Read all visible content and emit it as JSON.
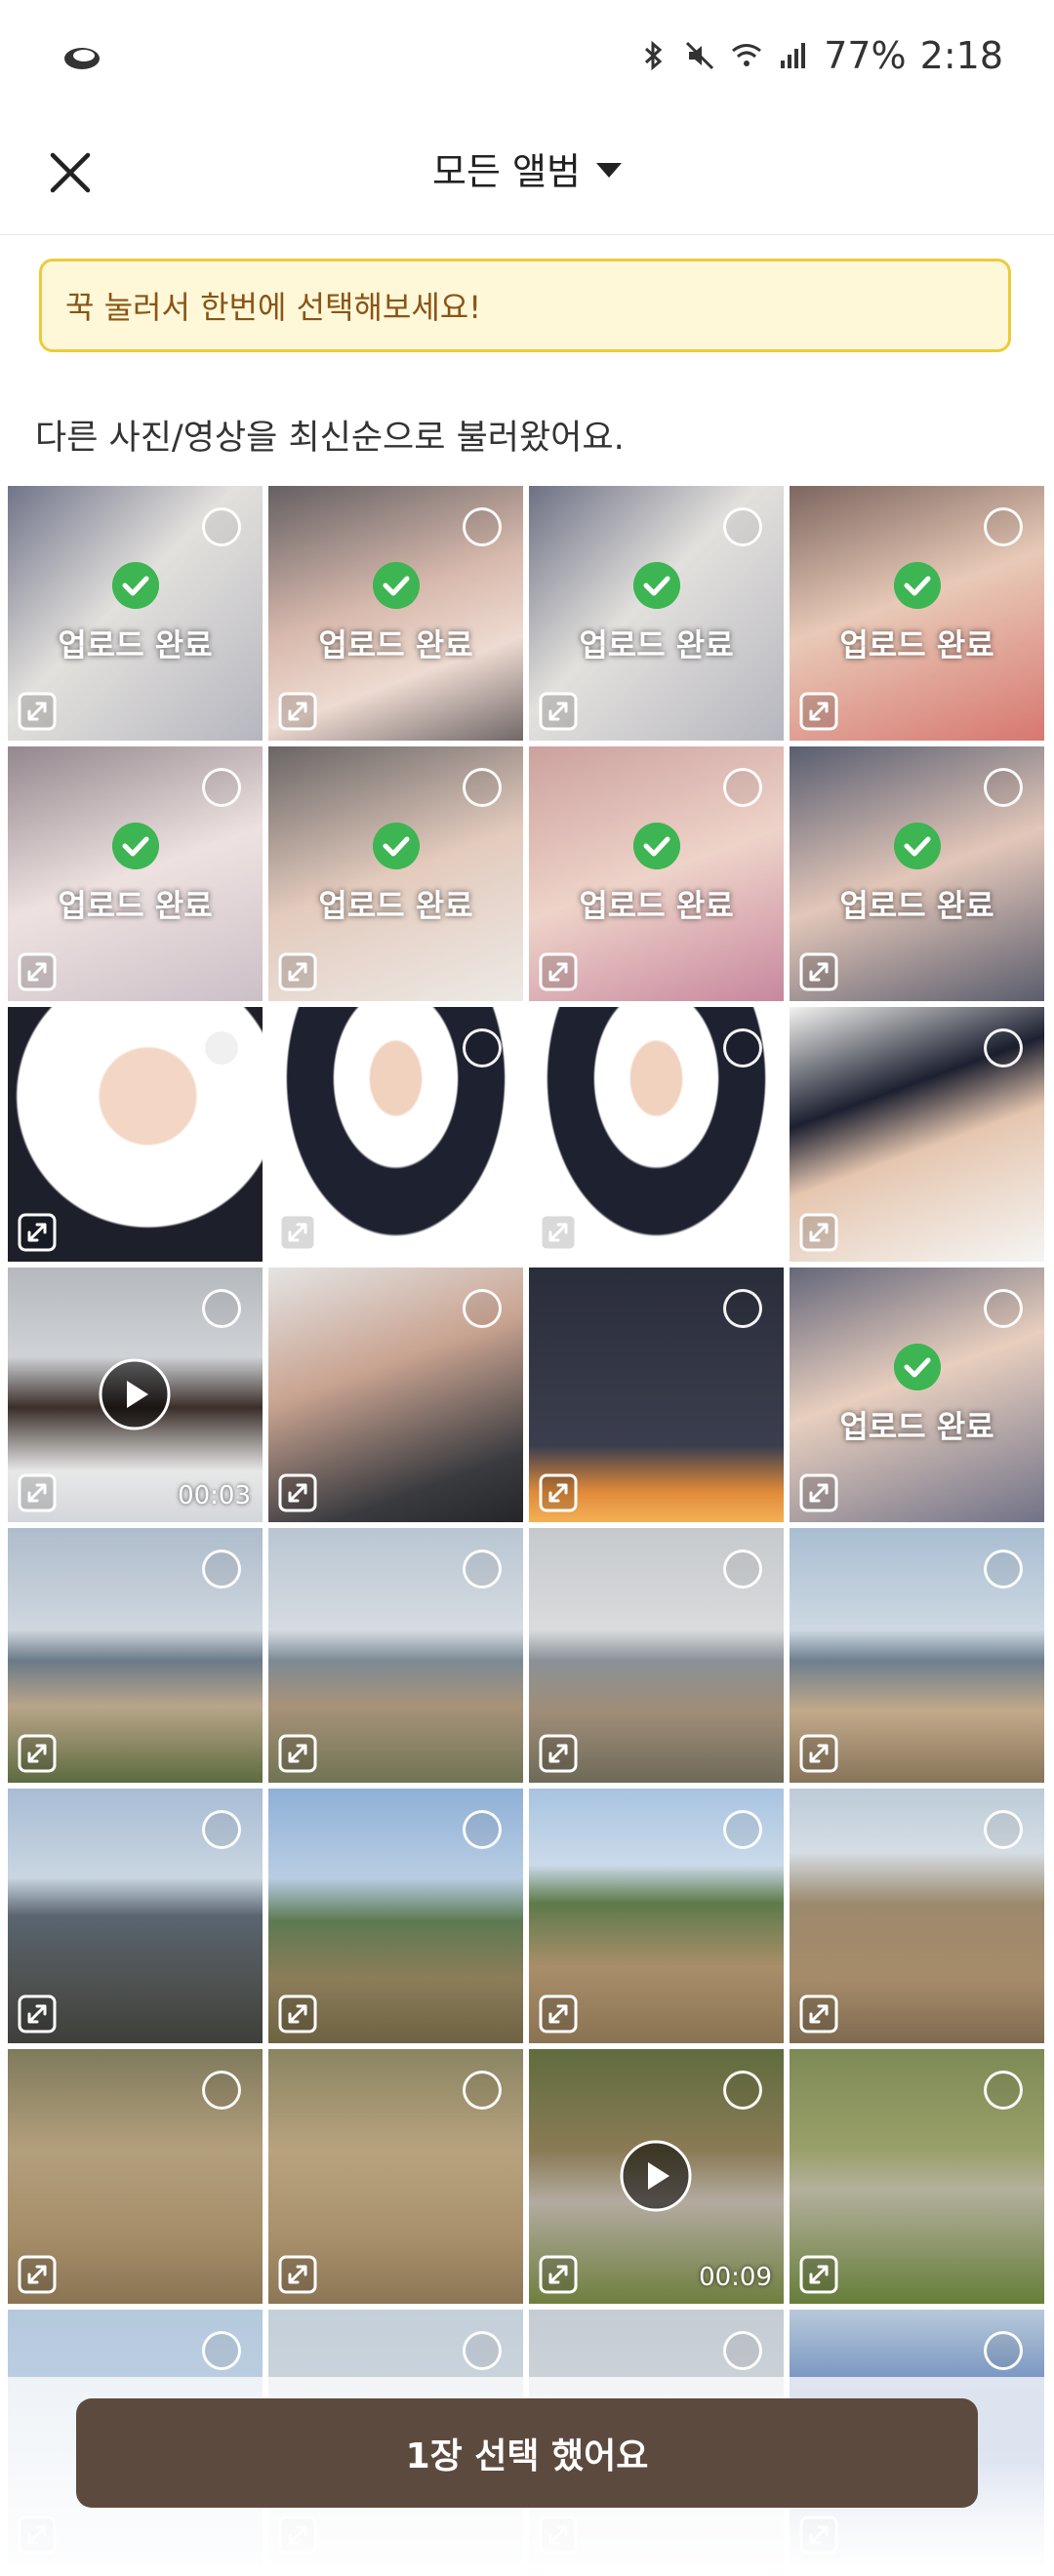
{
  "status_bar": {
    "battery": "77%",
    "time": "2:18"
  },
  "header": {
    "title": "모든 앨범"
  },
  "banner": {
    "text": "꾹 눌러서 한번에 선택해보세요!"
  },
  "subtitle": "다른 사진/영상을 최신순으로 불러왔어요.",
  "grid": {
    "uploaded_label": "업로드 완료",
    "items": [
      {
        "bg": "linear-gradient(135deg,#3a3f5c 0%,#d8d5d0 45%,#9a9aa6 100%)",
        "uploaded": true
      },
      {
        "bg": "linear-gradient(160deg,#2a2326 0%,#c99f8e 45%,#e8cdc0 70%,#3a2e2e 100%)",
        "uploaded": true
      },
      {
        "bg": "linear-gradient(135deg,#353a55 0%,#d8d5d0 45%,#9a9aa6 100%)",
        "uploaded": true
      },
      {
        "bg": "linear-gradient(160deg,#4a2c22 0%,#e0b59c 45%,#c8443a 100%)",
        "uploaded": true
      },
      {
        "bg": "linear-gradient(160deg,#6a5a63 0%,#e8d6d5 50%,#b8a8b2 100%)",
        "uploaded": true
      },
      {
        "bg": "linear-gradient(160deg,#2f2a2a 0%,#d9b7a4 50%,#e6e1dc 100%)",
        "uploaded": true
      },
      {
        "bg": "linear-gradient(160deg,#b87d78 0%,#e8c2b4 50%,#b25a7a 100%)",
        "uploaded": true
      },
      {
        "bg": "linear-gradient(160deg,#18203a 0%,#d8b19e 50%,#1c2036 100%)",
        "uploaded": true
      },
      {
        "bg": "radial-gradient(circle at 55% 35%,#f3d7c4 0%,#f3d7c4 22%,#ffffff 23%,#ffffff 60%,#1d1f2a 61%)",
        "uploaded": false
      },
      {
        "bg": "radial-gradient(ellipse at 50% 28%,#f0d2bf 0%,#f0d2bf 14%,#ffffff 15%,#ffffff 34%,#1e2130 35%,#1e2130 60%,#ffffff 61%)",
        "uploaded": false
      },
      {
        "bg": "radial-gradient(ellipse at 50% 28%,#f0d2bf 0%,#f0d2bf 14%,#ffffff 15%,#ffffff 34%,#1e2130 35%,#1e2130 60%,#ffffff 61%)",
        "uploaded": false
      },
      {
        "bg": "linear-gradient(160deg,#f2f2ef 0%,#1c2030 35%,#e5c6b0 55%,#f5f5f3 100%)",
        "uploaded": false
      },
      {
        "bg": "linear-gradient(180deg,#b5b8bd 0%,#cfd2d6 35%,#3a2f2a 55%,#e8e8e8 80%,#d3d6da 100%)",
        "uploaded": false,
        "video": true,
        "duration": "00:03"
      },
      {
        "bg": "linear-gradient(160deg,#e4e4e4 0%,#c9a391 40%,#3a3b3f 80%,#25262a 100%)",
        "uploaded": false
      },
      {
        "bg": "linear-gradient(180deg,#2a2d3a 0%,#3b3e4e 70%,#e08a3a 88%,#f4b054 100%)",
        "uploaded": false
      },
      {
        "bg": "linear-gradient(160deg,#2a2d48 0%,#dfbca6 45%,#3a3d5a 100%)",
        "uploaded": true
      },
      {
        "bg": "linear-gradient(180deg,#aebccc 0%,#cfd7df 40%,#6a7a88 52%,#b9a58a 70%,#5d6b3f 100%)",
        "uploaded": false
      },
      {
        "bg": "linear-gradient(180deg,#b9c6d2 0%,#d5dbe1 40%,#7c8a95 52%,#a89278 70%,#707454 100%)",
        "uploaded": false
      },
      {
        "bg": "linear-gradient(180deg,#c6c9cc 0%,#d9dbdd 40%,#8a9197 52%,#a08d78 72%,#6d6a58 100%)",
        "uploaded": false
      },
      {
        "bg": "linear-gradient(180deg,#a9bed2 0%,#cdd8e2 40%,#6e7f8e 52%,#c2a98a 72%,#877459 100%)",
        "uploaded": false
      },
      {
        "bg": "linear-gradient(180deg,#a8bcd3 0%,#c9d6e2 35%,#5a6570 50%,#4f5352 75%,#3e3f3a 100%)",
        "uploaded": false
      },
      {
        "bg": "linear-gradient(180deg,#8fb0d6 0%,#b8cde4 35%,#5d7a52 52%,#8c7d5a 75%,#6d6242 100%)",
        "uploaded": false
      },
      {
        "bg": "linear-gradient(180deg,#a8c4e0 0%,#cadaea 30%,#5e7a4a 45%,#a98e6a 70%,#8a7352 100%)",
        "uploaded": false
      },
      {
        "bg": "linear-gradient(180deg,#bccbd8 0%,#d5dde4 25%,#9c8a6e 45%,#a68b69 75%,#7e6b50 100%)",
        "uploaded": false
      },
      {
        "bg": "linear-gradient(180deg,#7f7a5c 0%,#b39f7c 40%,#a58c68 75%,#8a7454 100%)",
        "uploaded": false
      },
      {
        "bg": "linear-gradient(180deg,#8a8562 0%,#b8a27e 40%,#a88f6b 75%,#8c7655 100%)",
        "uploaded": false
      },
      {
        "bg": "linear-gradient(180deg,#5f6c3e 0%,#8a7b55 40%,#b3aba0 60%,#6e7f3e 100%)",
        "uploaded": false,
        "video": true,
        "duration": "00:09"
      },
      {
        "bg": "linear-gradient(180deg,#7d8a55 0%,#9aa06a 40%,#b4b09c 55%,#667e39 100%)",
        "uploaded": false
      },
      {
        "bg": "linear-gradient(180deg,#b5c9de 0%,#cbd8e6 100%)",
        "uploaded": false
      },
      {
        "bg": "linear-gradient(180deg,#c4cfd9 0%,#d8dfe5 100%)",
        "uploaded": false
      },
      {
        "bg": "linear-gradient(180deg,#c5ccd3 0%,#dbe0e4 100%)",
        "uploaded": false
      },
      {
        "bg": "linear-gradient(180deg,#b8c9da 0%,#2f5aa6 60%,#cfd8e1 100%)",
        "uploaded": false
      }
    ]
  },
  "cta": {
    "label": "1장 선택 했어요"
  }
}
